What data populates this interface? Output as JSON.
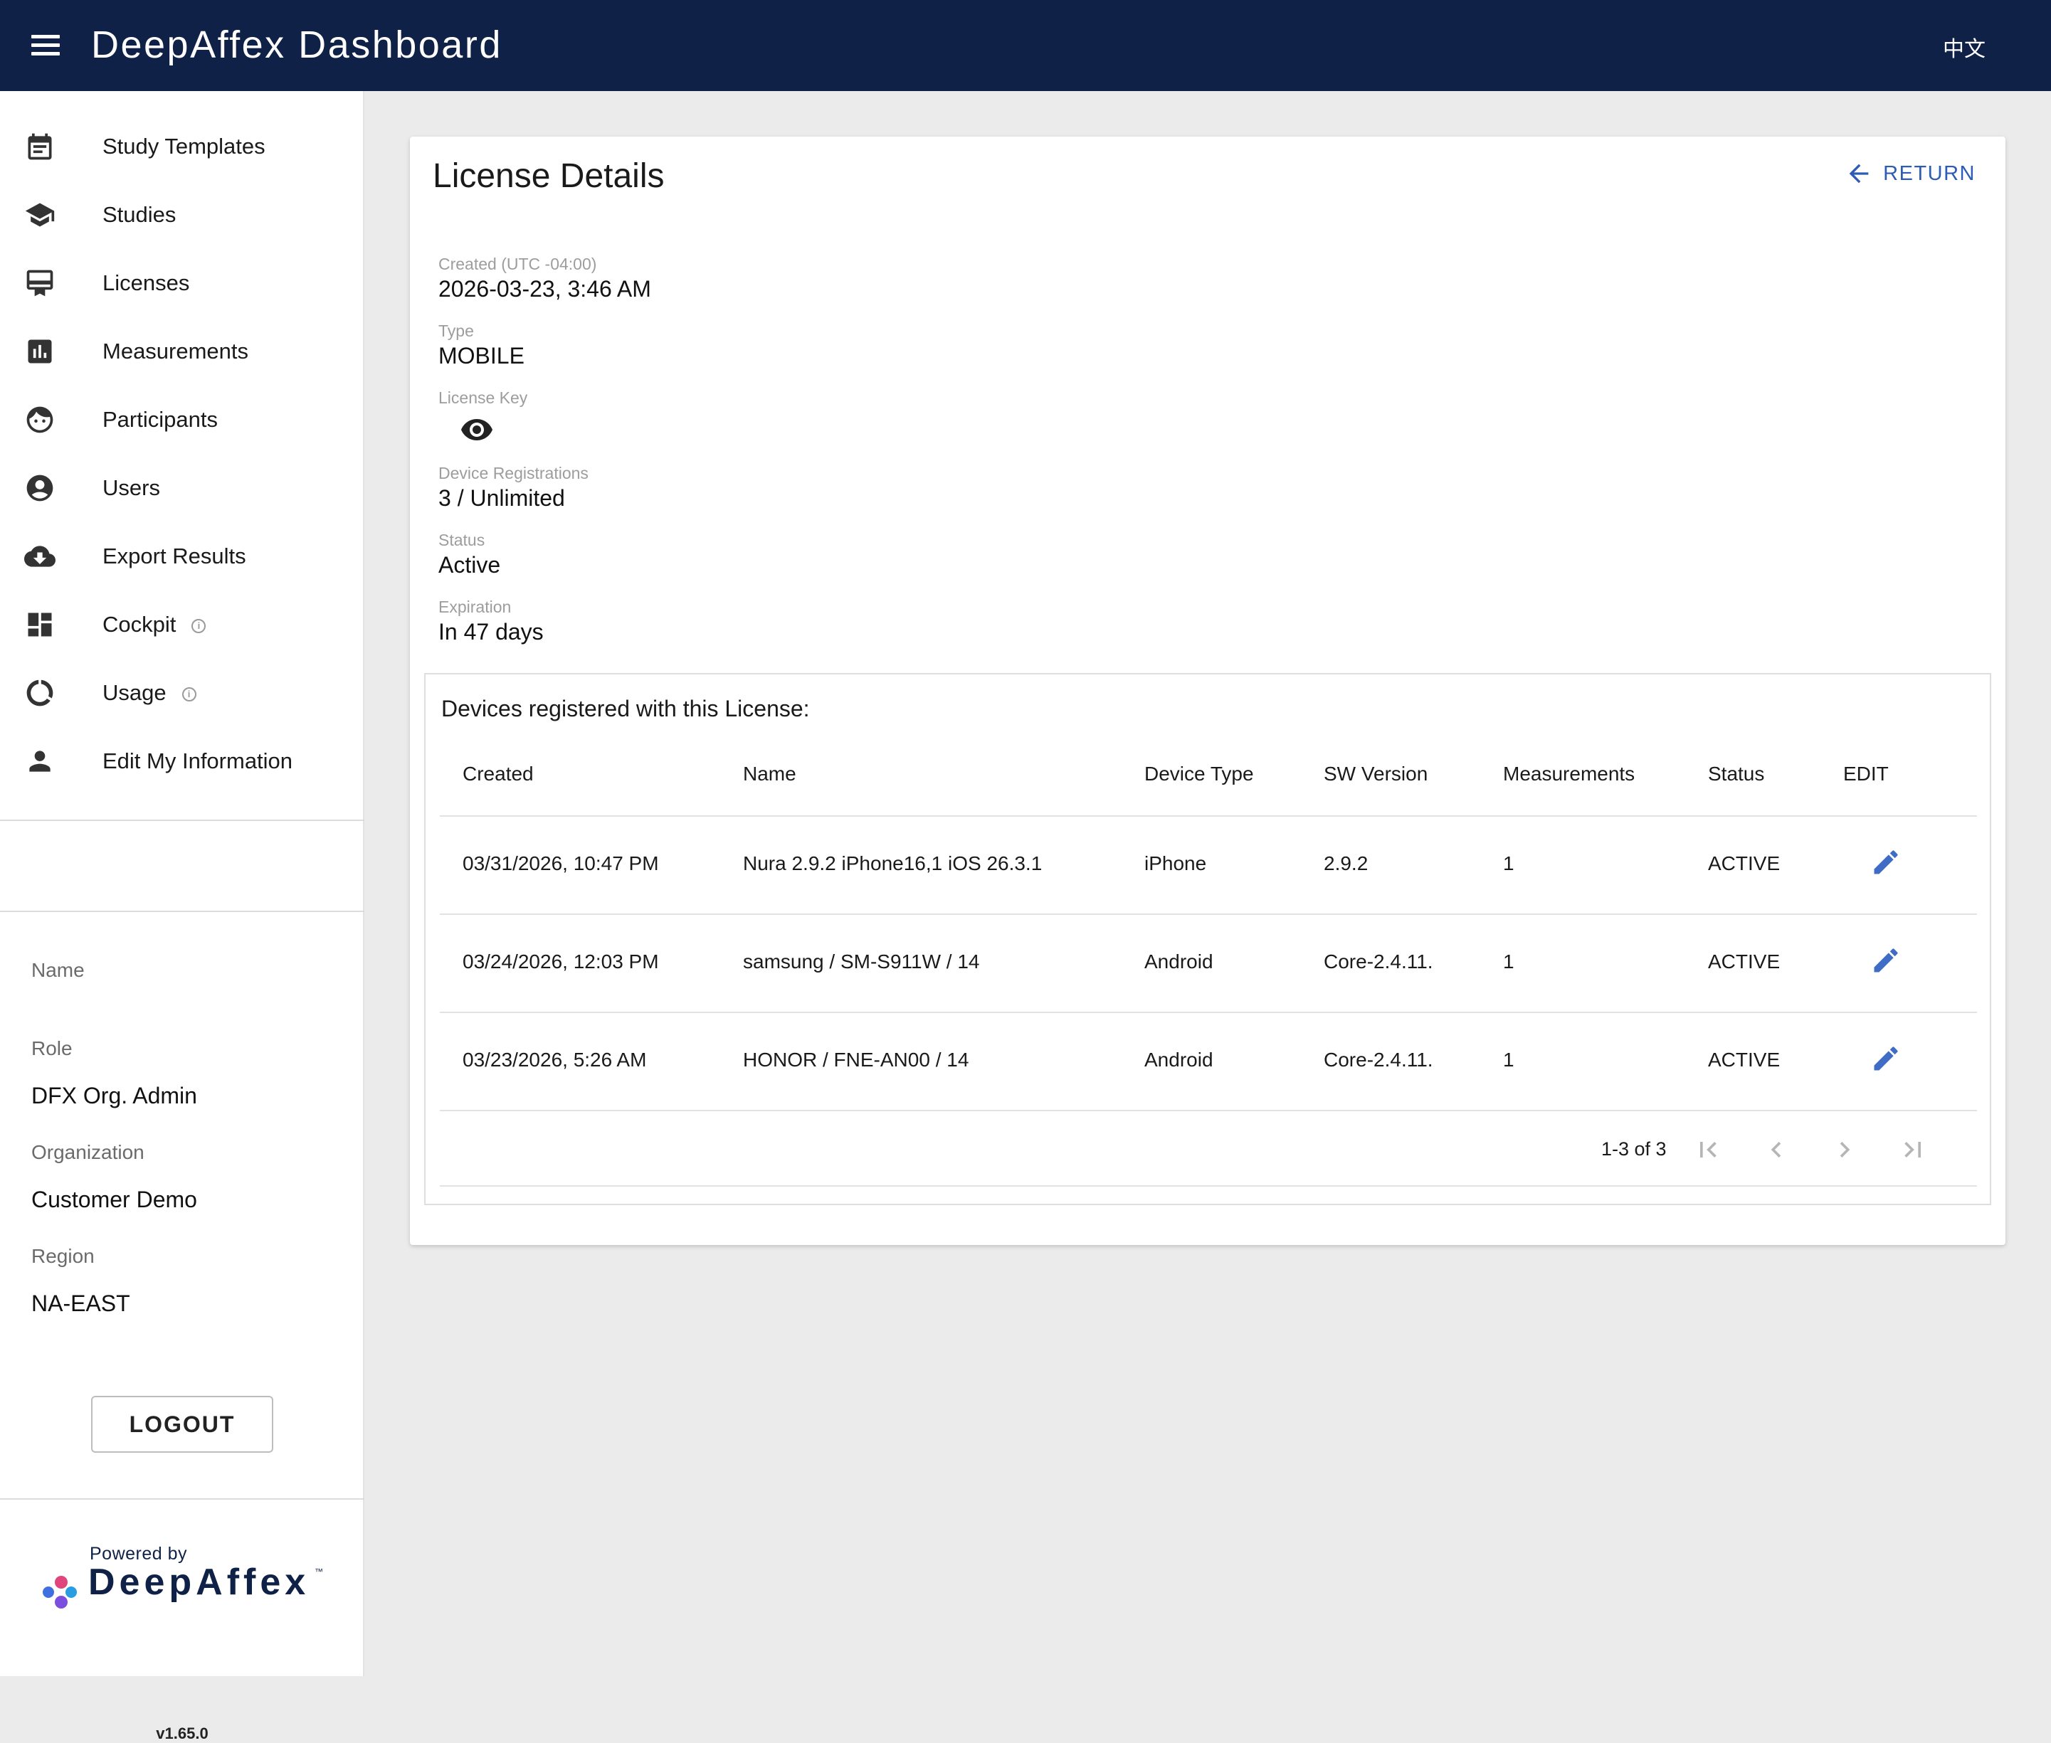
{
  "header": {
    "title": "DeepAffex Dashboard",
    "language_toggle": "中文",
    "bar_color": "#102147"
  },
  "sidebar": {
    "items": [
      {
        "label": "Study Templates",
        "icon": "calendar-icon"
      },
      {
        "label": "Studies",
        "icon": "graduation-cap-icon"
      },
      {
        "label": "Licenses",
        "icon": "card-membership-icon"
      },
      {
        "label": "Measurements",
        "icon": "bar-chart-icon"
      },
      {
        "label": "Participants",
        "icon": "face-icon"
      },
      {
        "label": "Users",
        "icon": "account-circle-icon"
      },
      {
        "label": "Export Results",
        "icon": "cloud-download-icon"
      },
      {
        "label": "Cockpit",
        "icon": "dashboard-icon",
        "info": "i"
      },
      {
        "label": "Usage",
        "icon": "donut-icon",
        "info": "i"
      },
      {
        "label": "Edit My Information",
        "icon": "person-icon"
      }
    ],
    "user_info": {
      "name_label": "Name",
      "name_value": "",
      "role_label": "Role",
      "role_value": "DFX Org. Admin",
      "organization_label": "Organization",
      "organization_value": "Customer Demo",
      "region_label": "Region",
      "region_value": "NA-EAST"
    },
    "logout_label": "LOGOUT",
    "powered_by": "Powered by",
    "brand_name": "DeepAffex",
    "trademark": "™",
    "version": "v1.65.0"
  },
  "license": {
    "title": "License Details",
    "return_label": "RETURN",
    "accent_color": "#2c5cb5",
    "fields": {
      "created_label": "Created (UTC -04:00)",
      "created_value": "2026-03-23, 3:46 AM",
      "type_label": "Type",
      "type_value": "MOBILE",
      "key_label": "License Key",
      "registrations_label": "Device Registrations",
      "registrations_value": "3 / Unlimited",
      "status_label": "Status",
      "status_value": "Active",
      "expiration_label": "Expiration",
      "expiration_value": "In 47 days"
    },
    "devices": {
      "title": "Devices registered with this License:",
      "columns": [
        "Created",
        "Name",
        "Device Type",
        "SW Version",
        "Measurements",
        "Status",
        "EDIT"
      ],
      "rows": [
        {
          "created": "03/31/2026, 10:47 PM",
          "name": "Nura 2.9.2 iPhone16,1 iOS 26.3.1",
          "device_type": "iPhone",
          "sw_version": "2.9.2",
          "measurements": "1",
          "status": "ACTIVE"
        },
        {
          "created": "03/24/2026, 12:03 PM",
          "name": "samsung / SM-S911W / 14",
          "device_type": "Android",
          "sw_version": "Core-2.4.11.",
          "measurements": "1",
          "status": "ACTIVE"
        },
        {
          "created": "03/23/2026, 5:26 AM",
          "name": "HONOR / FNE-AN00 / 14",
          "device_type": "Android",
          "sw_version": "Core-2.4.11.",
          "measurements": "1",
          "status": "ACTIVE"
        }
      ],
      "pagination": "1-3 of 3"
    }
  }
}
